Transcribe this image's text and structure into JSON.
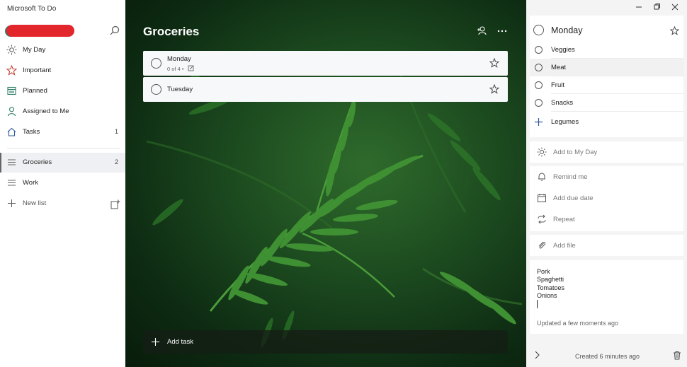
{
  "app": {
    "title": "Microsoft To Do"
  },
  "sidebar": {
    "items": [
      {
        "label": "My Day",
        "icon": "sun-icon",
        "count": ""
      },
      {
        "label": "Important",
        "icon": "star-icon",
        "count": ""
      },
      {
        "label": "Planned",
        "icon": "calendar-icon",
        "count": ""
      },
      {
        "label": "Assigned to Me",
        "icon": "person-icon",
        "count": ""
      },
      {
        "label": "Tasks",
        "icon": "home-icon",
        "count": "1"
      }
    ],
    "lists": [
      {
        "label": "Groceries",
        "icon": "list-icon",
        "count": "2",
        "active": true
      },
      {
        "label": "Work",
        "icon": "list-icon",
        "count": ""
      }
    ],
    "new_list": "New list"
  },
  "main": {
    "title": "Groceries",
    "tasks": [
      {
        "name": "Monday",
        "meta": "0 of 4  •",
        "starred": false
      },
      {
        "name": "Tuesday",
        "meta": "",
        "starred": false
      }
    ],
    "add_task": "Add task"
  },
  "detail": {
    "title": "Monday",
    "steps": [
      "Veggies",
      "Meat",
      "Fruit",
      "Snacks"
    ],
    "new_step": "Legumes",
    "add_to_my_day": "Add to My Day",
    "remind_me": "Remind me",
    "add_due_date": "Add due date",
    "repeat": "Repeat",
    "add_file": "Add file",
    "note_lines": [
      "Pork",
      "Spaghetti",
      "Tomatoes",
      "Onions"
    ],
    "note_updated": "Updated a few moments ago",
    "created": "Created 6 minutes ago"
  },
  "colors": {
    "accent": "#2b579a",
    "important": "#c0392b",
    "planned": "#2e7d67",
    "assigned": "#2e7d67"
  }
}
